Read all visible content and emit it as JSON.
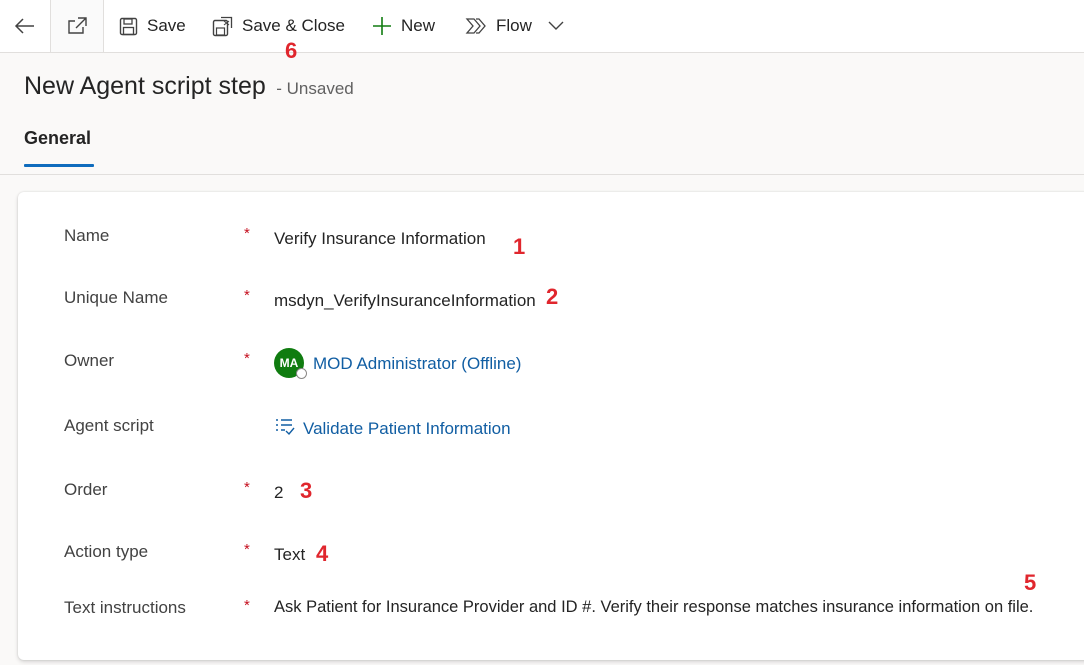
{
  "toolbar": {
    "save_label": "Save",
    "save_close_label": "Save & Close",
    "new_label": "New",
    "flow_label": "Flow"
  },
  "header": {
    "title": "New Agent script step",
    "status": "- Unsaved"
  },
  "tabs": [
    {
      "label": "General",
      "selected": true
    }
  ],
  "form": {
    "name": {
      "label": "Name",
      "value": "Verify Insurance Information",
      "required": true
    },
    "unique_name": {
      "label": "Unique Name",
      "value": "msdyn_VerifyInsuranceInformation",
      "required": true
    },
    "owner": {
      "label": "Owner",
      "value": "MOD Administrator (Offline)",
      "avatar_initials": "MA",
      "required": true
    },
    "agent_script": {
      "label": "Agent script",
      "value": "Validate Patient Information",
      "required": false
    },
    "order": {
      "label": "Order",
      "value": "2",
      "required": true
    },
    "action_type": {
      "label": "Action type",
      "value": "Text",
      "required": true
    },
    "text_instructions": {
      "label": "Text instructions",
      "value": "Ask Patient for Insurance Provider and ID #. Verify their response matches insurance information on file.",
      "required": true
    }
  },
  "required_marker": "*",
  "annotations": [
    "1",
    "2",
    "3",
    "4",
    "5",
    "6"
  ],
  "colors": {
    "accent": "#0f6cbd",
    "link": "#115ea3",
    "required": "#c50f1f",
    "annotation": "#e0262d",
    "avatar": "#107c10"
  }
}
